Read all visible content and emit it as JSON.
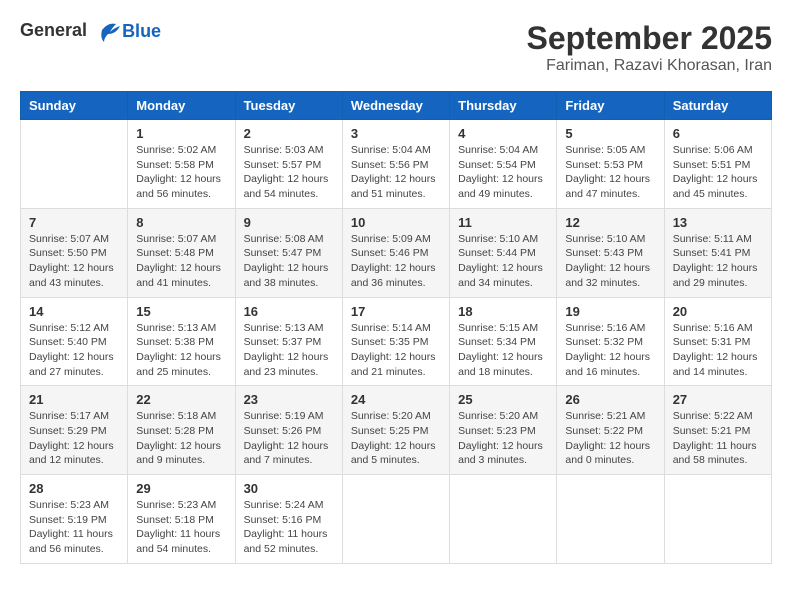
{
  "header": {
    "logo_line1": "General",
    "logo_line2": "Blue",
    "month": "September 2025",
    "location": "Fariman, Razavi Khorasan, Iran"
  },
  "days_of_week": [
    "Sunday",
    "Monday",
    "Tuesday",
    "Wednesday",
    "Thursday",
    "Friday",
    "Saturday"
  ],
  "weeks": [
    [
      {
        "day": "",
        "info": ""
      },
      {
        "day": "1",
        "info": "Sunrise: 5:02 AM\nSunset: 5:58 PM\nDaylight: 12 hours\nand 56 minutes."
      },
      {
        "day": "2",
        "info": "Sunrise: 5:03 AM\nSunset: 5:57 PM\nDaylight: 12 hours\nand 54 minutes."
      },
      {
        "day": "3",
        "info": "Sunrise: 5:04 AM\nSunset: 5:56 PM\nDaylight: 12 hours\nand 51 minutes."
      },
      {
        "day": "4",
        "info": "Sunrise: 5:04 AM\nSunset: 5:54 PM\nDaylight: 12 hours\nand 49 minutes."
      },
      {
        "day": "5",
        "info": "Sunrise: 5:05 AM\nSunset: 5:53 PM\nDaylight: 12 hours\nand 47 minutes."
      },
      {
        "day": "6",
        "info": "Sunrise: 5:06 AM\nSunset: 5:51 PM\nDaylight: 12 hours\nand 45 minutes."
      }
    ],
    [
      {
        "day": "7",
        "info": "Sunrise: 5:07 AM\nSunset: 5:50 PM\nDaylight: 12 hours\nand 43 minutes."
      },
      {
        "day": "8",
        "info": "Sunrise: 5:07 AM\nSunset: 5:48 PM\nDaylight: 12 hours\nand 41 minutes."
      },
      {
        "day": "9",
        "info": "Sunrise: 5:08 AM\nSunset: 5:47 PM\nDaylight: 12 hours\nand 38 minutes."
      },
      {
        "day": "10",
        "info": "Sunrise: 5:09 AM\nSunset: 5:46 PM\nDaylight: 12 hours\nand 36 minutes."
      },
      {
        "day": "11",
        "info": "Sunrise: 5:10 AM\nSunset: 5:44 PM\nDaylight: 12 hours\nand 34 minutes."
      },
      {
        "day": "12",
        "info": "Sunrise: 5:10 AM\nSunset: 5:43 PM\nDaylight: 12 hours\nand 32 minutes."
      },
      {
        "day": "13",
        "info": "Sunrise: 5:11 AM\nSunset: 5:41 PM\nDaylight: 12 hours\nand 29 minutes."
      }
    ],
    [
      {
        "day": "14",
        "info": "Sunrise: 5:12 AM\nSunset: 5:40 PM\nDaylight: 12 hours\nand 27 minutes."
      },
      {
        "day": "15",
        "info": "Sunrise: 5:13 AM\nSunset: 5:38 PM\nDaylight: 12 hours\nand 25 minutes."
      },
      {
        "day": "16",
        "info": "Sunrise: 5:13 AM\nSunset: 5:37 PM\nDaylight: 12 hours\nand 23 minutes."
      },
      {
        "day": "17",
        "info": "Sunrise: 5:14 AM\nSunset: 5:35 PM\nDaylight: 12 hours\nand 21 minutes."
      },
      {
        "day": "18",
        "info": "Sunrise: 5:15 AM\nSunset: 5:34 PM\nDaylight: 12 hours\nand 18 minutes."
      },
      {
        "day": "19",
        "info": "Sunrise: 5:16 AM\nSunset: 5:32 PM\nDaylight: 12 hours\nand 16 minutes."
      },
      {
        "day": "20",
        "info": "Sunrise: 5:16 AM\nSunset: 5:31 PM\nDaylight: 12 hours\nand 14 minutes."
      }
    ],
    [
      {
        "day": "21",
        "info": "Sunrise: 5:17 AM\nSunset: 5:29 PM\nDaylight: 12 hours\nand 12 minutes."
      },
      {
        "day": "22",
        "info": "Sunrise: 5:18 AM\nSunset: 5:28 PM\nDaylight: 12 hours\nand 9 minutes."
      },
      {
        "day": "23",
        "info": "Sunrise: 5:19 AM\nSunset: 5:26 PM\nDaylight: 12 hours\nand 7 minutes."
      },
      {
        "day": "24",
        "info": "Sunrise: 5:20 AM\nSunset: 5:25 PM\nDaylight: 12 hours\nand 5 minutes."
      },
      {
        "day": "25",
        "info": "Sunrise: 5:20 AM\nSunset: 5:23 PM\nDaylight: 12 hours\nand 3 minutes."
      },
      {
        "day": "26",
        "info": "Sunrise: 5:21 AM\nSunset: 5:22 PM\nDaylight: 12 hours\nand 0 minutes."
      },
      {
        "day": "27",
        "info": "Sunrise: 5:22 AM\nSunset: 5:21 PM\nDaylight: 11 hours\nand 58 minutes."
      }
    ],
    [
      {
        "day": "28",
        "info": "Sunrise: 5:23 AM\nSunset: 5:19 PM\nDaylight: 11 hours\nand 56 minutes."
      },
      {
        "day": "29",
        "info": "Sunrise: 5:23 AM\nSunset: 5:18 PM\nDaylight: 11 hours\nand 54 minutes."
      },
      {
        "day": "30",
        "info": "Sunrise: 5:24 AM\nSunset: 5:16 PM\nDaylight: 11 hours\nand 52 minutes."
      },
      {
        "day": "",
        "info": ""
      },
      {
        "day": "",
        "info": ""
      },
      {
        "day": "",
        "info": ""
      },
      {
        "day": "",
        "info": ""
      }
    ]
  ]
}
